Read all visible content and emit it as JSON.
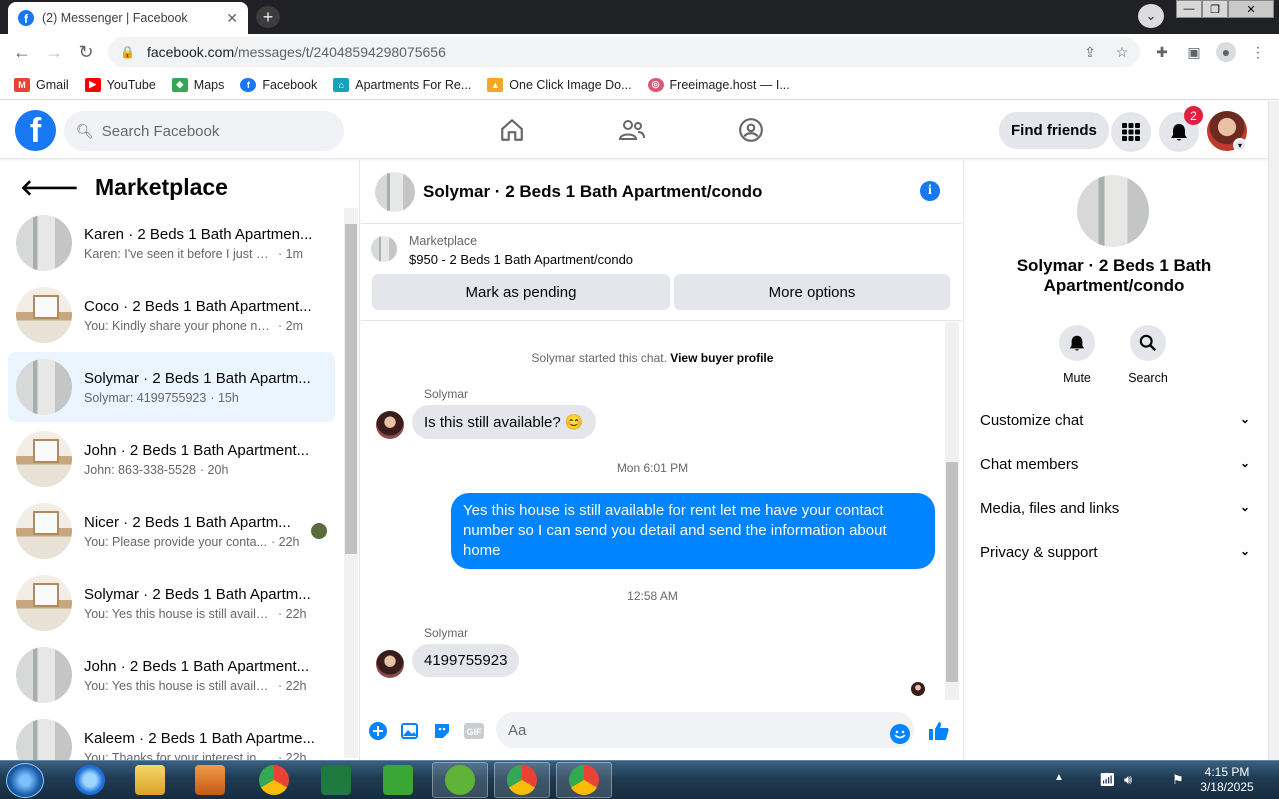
{
  "browser": {
    "tab_title": "(2) Messenger | Facebook",
    "url_host": "facebook.com",
    "url_path": "/messages/t/24048594298075656",
    "bookmarks": [
      {
        "label": "Gmail",
        "color": "#ea4335"
      },
      {
        "label": "YouTube",
        "color": "#ff0000"
      },
      {
        "label": "Maps",
        "color": "#34a853"
      },
      {
        "label": "Facebook",
        "color": "#1877f2"
      },
      {
        "label": "Apartments For Re...",
        "color": "#14a3b8"
      },
      {
        "label": "One Click Image Do...",
        "color": "#f5a623"
      },
      {
        "label": "Freeimage.host — I...",
        "color": "#e0567a"
      }
    ]
  },
  "facebook": {
    "search_placeholder": "Search Facebook",
    "find_friends": "Find friends",
    "notification_count": "2"
  },
  "sidebar": {
    "title": "Marketplace",
    "conversations": [
      {
        "name": "Karen · 2 Beds 1 Bath Apartmen...",
        "preview": "Karen: I've seen it before I just wa...",
        "time": "· 1m",
        "thumb": "grey",
        "active": false
      },
      {
        "name": "Coco · 2 Beds 1 Bath Apartment...",
        "preview": "You: Kindly share your phone num...",
        "time": "· 2m",
        "thumb": "warm",
        "active": false
      },
      {
        "name": "Solymar · 2 Beds 1 Bath Apartm...",
        "preview": "Solymar: 4199755923",
        "time": "· 15h",
        "thumb": "grey",
        "active": true
      },
      {
        "name": "John · 2 Beds 1 Bath Apartment...",
        "preview": "John: 863-338-5528",
        "time": "· 20h",
        "thumb": "warm",
        "active": false
      },
      {
        "name": "Nicer · 2 Beds 1 Bath Apartm...",
        "preview": "You: Please provide your conta...",
        "time": "· 22h",
        "thumb": "warm",
        "active": false
      },
      {
        "name": "Solymar · 2 Beds 1 Bath Apartm...",
        "preview": "You: Yes this house is still availabl...",
        "time": "· 22h",
        "thumb": "warm",
        "active": false
      },
      {
        "name": "John · 2 Beds 1 Bath Apartment...",
        "preview": "You: Yes this house is still availabl...",
        "time": "· 22h",
        "thumb": "grey",
        "active": false
      },
      {
        "name": "Kaleem · 2 Beds 1 Bath Apartme...",
        "preview": "You: Thanks for your interest in th...",
        "time": "· 22h",
        "thumb": "grey",
        "active": false
      }
    ]
  },
  "chat": {
    "title": "Solymar · 2 Beds 1 Bath Apartment/condo",
    "marketplace_label": "Marketplace",
    "listing": "$950 - 2 Beds 1 Bath Apartment/condo",
    "mark_pending": "Mark as pending",
    "more_options": "More options",
    "started_text": "Solymar started this chat.",
    "view_profile": "View buyer profile",
    "sender1": "Solymar",
    "msg1": "Is this still available? 😊",
    "ts1": "Mon 6:01 PM",
    "msg2": "Yes this house is still available for rent let me have your contact number so I can send you detail and send the information about home",
    "ts2": "12:58 AM",
    "sender2": "Solymar",
    "msg3": "4199755923",
    "composer_placeholder": "Aa"
  },
  "details": {
    "name": "Solymar · 2 Beds 1 Bath Apartment/condo",
    "mute": "Mute",
    "search": "Search",
    "rows": [
      "Customize chat",
      "Chat members",
      "Media, files and links",
      "Privacy & support"
    ]
  },
  "taskbar": {
    "time": "4:15 PM",
    "date": "3/18/2025"
  }
}
